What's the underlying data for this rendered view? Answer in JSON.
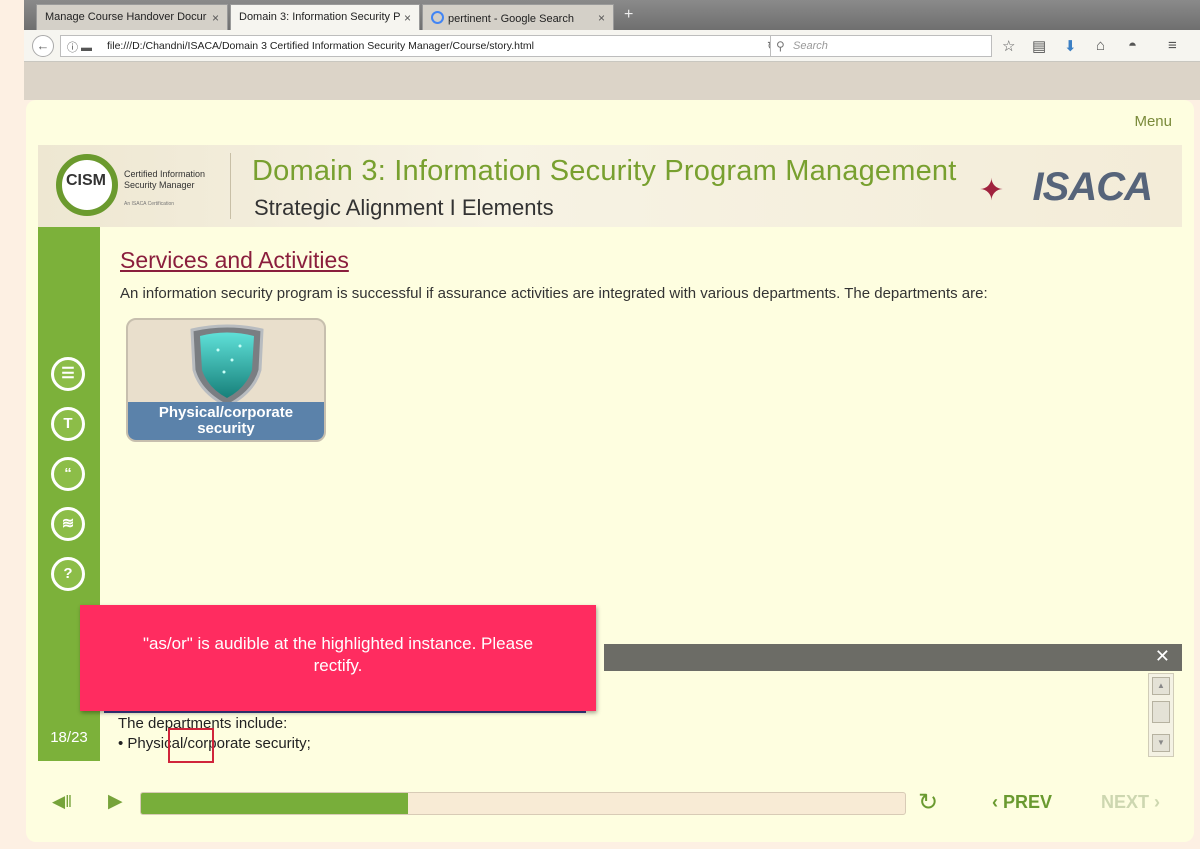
{
  "browser": {
    "tabs": [
      {
        "label": "Manage Course Handover Docur",
        "active": false
      },
      {
        "label": "Domain 3: Information Security P",
        "active": true
      },
      {
        "label": "pertinent - Google Search",
        "active": false
      }
    ],
    "url": "file:///D:/Chandni/ISACA/Domain 3 Certified Information Security Manager/Course/story.html",
    "search_placeholder": "Search"
  },
  "player": {
    "menu_label": "Menu",
    "banner": {
      "cism_logo_text": "CISM",
      "cism_sub_line1": "Certified Information",
      "cism_sub_line2": "Security Manager",
      "cism_tiny": "An ISACA Certification",
      "title": "Domain 3: Information Security Program Management",
      "subtitle": "Strategic Alignment I Elements",
      "brand": "ISACA"
    },
    "sidebar": {
      "icons": [
        "notes-icon",
        "transcript-icon",
        "quote-icon",
        "resources-icon",
        "help-icon"
      ],
      "icon_glyphs": [
        "☰",
        "T",
        "“",
        "≋",
        "?"
      ],
      "page_counter": "18/23"
    },
    "content": {
      "section_title": "Services and Activities",
      "intro": "An information security program is successful if assurance activities are integrated with various departments. The departments are:",
      "card_line1": "Physical/corporate",
      "card_line2": "security"
    },
    "notes": {
      "close": "✕",
      "line1": "The departments include:",
      "line2": "• Physical/corporate security;"
    },
    "controls": {
      "progress": 0.35,
      "prev_label": "PREV",
      "next_label": "NEXT"
    }
  },
  "review_comment": {
    "text": "\"as/or\" is audible at the highlighted instance. Please rectify."
  },
  "colors": {
    "accent_green": "#7cb13a",
    "title_maroon": "#8a1e3d",
    "comment_pink": "#ff2c60",
    "highlight_red": "#d0253b"
  }
}
